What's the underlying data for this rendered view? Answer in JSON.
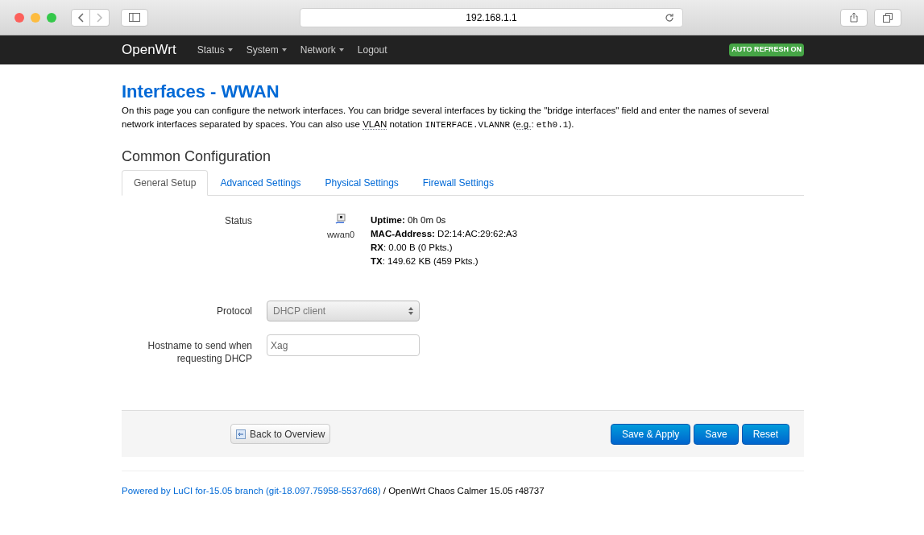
{
  "browser": {
    "address": "192.168.1.1"
  },
  "nav": {
    "brand": "OpenWrt",
    "menus": [
      {
        "label": "Status",
        "dropdown": true
      },
      {
        "label": "System",
        "dropdown": true
      },
      {
        "label": "Network",
        "dropdown": true
      },
      {
        "label": "Logout",
        "dropdown": false
      }
    ],
    "badge": "AUTO REFRESH ON"
  },
  "title": "Interfaces - WWAN",
  "description": [
    {
      "kind": "text",
      "text": "On this page you can configure the network interfaces. You can bridge several interfaces by ticking the \"bridge interfaces\" field and enter the names of several network interfaces separated by spaces. You can also use "
    },
    {
      "kind": "abbr",
      "text": "VLAN"
    },
    {
      "kind": "text",
      "text": " notation "
    },
    {
      "kind": "code",
      "text": "INTERFACE.VLANNR"
    },
    {
      "kind": "text",
      "text": " ("
    },
    {
      "kind": "abbr",
      "text": "e.g."
    },
    {
      "kind": "text",
      "text": ": "
    },
    {
      "kind": "code",
      "text": "eth0.1"
    },
    {
      "kind": "text",
      "text": ")."
    }
  ],
  "section_title": "Common Configuration",
  "tabs": [
    {
      "label": "General Setup",
      "selected": true
    },
    {
      "label": "Advanced Settings",
      "selected": false
    },
    {
      "label": "Physical Settings",
      "selected": false
    },
    {
      "label": "Firewall Settings",
      "selected": false
    }
  ],
  "status": {
    "label": "Status",
    "device": "wwan0",
    "lines": [
      {
        "key": "Uptime:",
        "value": " 0h 0m 0s"
      },
      {
        "key": "MAC-Address:",
        "value": " D2:14:AC:29:62:A3"
      },
      {
        "key": "RX",
        "value": ": 0.00 B (0 Pkts.)"
      },
      {
        "key": "TX",
        "value": ": 149.62 KB (459 Pkts.)"
      }
    ]
  },
  "protocol": {
    "label": "Protocol",
    "value": "DHCP client"
  },
  "hostname": {
    "label": "Hostname to send when requesting DHCP",
    "value": "Xag"
  },
  "actions": {
    "back": "Back to Overview",
    "buttons": [
      "Save & Apply",
      "Save",
      "Reset"
    ]
  },
  "footer": {
    "link": "Powered by LuCI for-15.05 branch (git-18.097.75958-5537d68)",
    "text": " / OpenWrt Chaos Calmer 15.05 r48737"
  }
}
